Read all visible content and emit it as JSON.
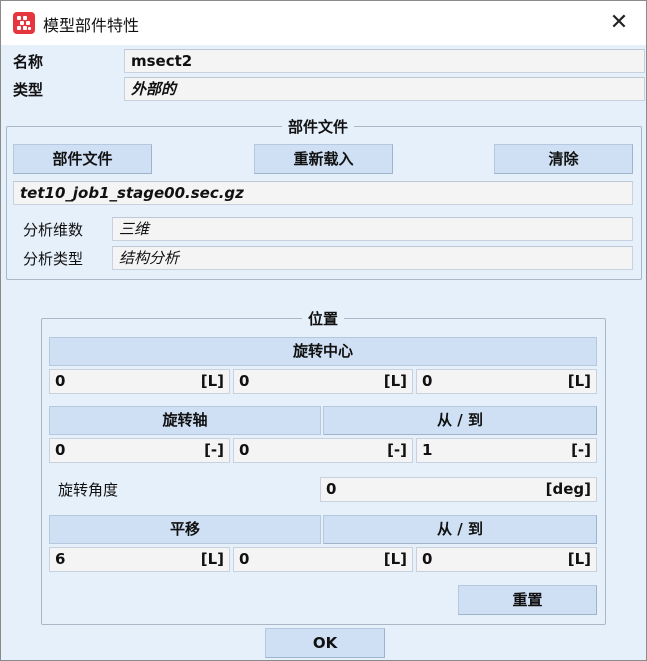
{
  "window": {
    "title": "模型部件特性",
    "close_symbol": "✕"
  },
  "properties": {
    "name_label": "名称",
    "name_value": "msect2",
    "type_label": "类型",
    "type_value": "外部的"
  },
  "part_file": {
    "group_title": "部件文件",
    "buttons": {
      "part_file": "部件文件",
      "reload": "重新载入",
      "clear": "清除"
    },
    "filename": "tet10_job1_stage00.sec.gz",
    "dimension_label": "分析维数",
    "dimension_value": "三维",
    "analysis_type_label": "分析类型",
    "analysis_type_value": "结构分析"
  },
  "position": {
    "group_title": "位置",
    "rotation_center": {
      "header": "旋转中心",
      "values": [
        {
          "value": "0",
          "unit": "[L]"
        },
        {
          "value": "0",
          "unit": "[L]"
        },
        {
          "value": "0",
          "unit": "[L]"
        }
      ]
    },
    "rotation_axis": {
      "header": "旋转轴",
      "from_to_header": "从 / 到",
      "values": [
        {
          "value": "0",
          "unit": "[-]"
        },
        {
          "value": "0",
          "unit": "[-]"
        },
        {
          "value": "1",
          "unit": "[-]"
        }
      ]
    },
    "rotation_angle": {
      "label": "旋转角度",
      "value": "0",
      "unit": "[deg]"
    },
    "translation": {
      "header": "平移",
      "from_to_header": "从 / 到",
      "values": [
        {
          "value": "6",
          "unit": "[L]"
        },
        {
          "value": "0",
          "unit": "[L]"
        },
        {
          "value": "0",
          "unit": "[L]"
        }
      ]
    },
    "reset_label": "重置"
  },
  "ok_label": "OK"
}
